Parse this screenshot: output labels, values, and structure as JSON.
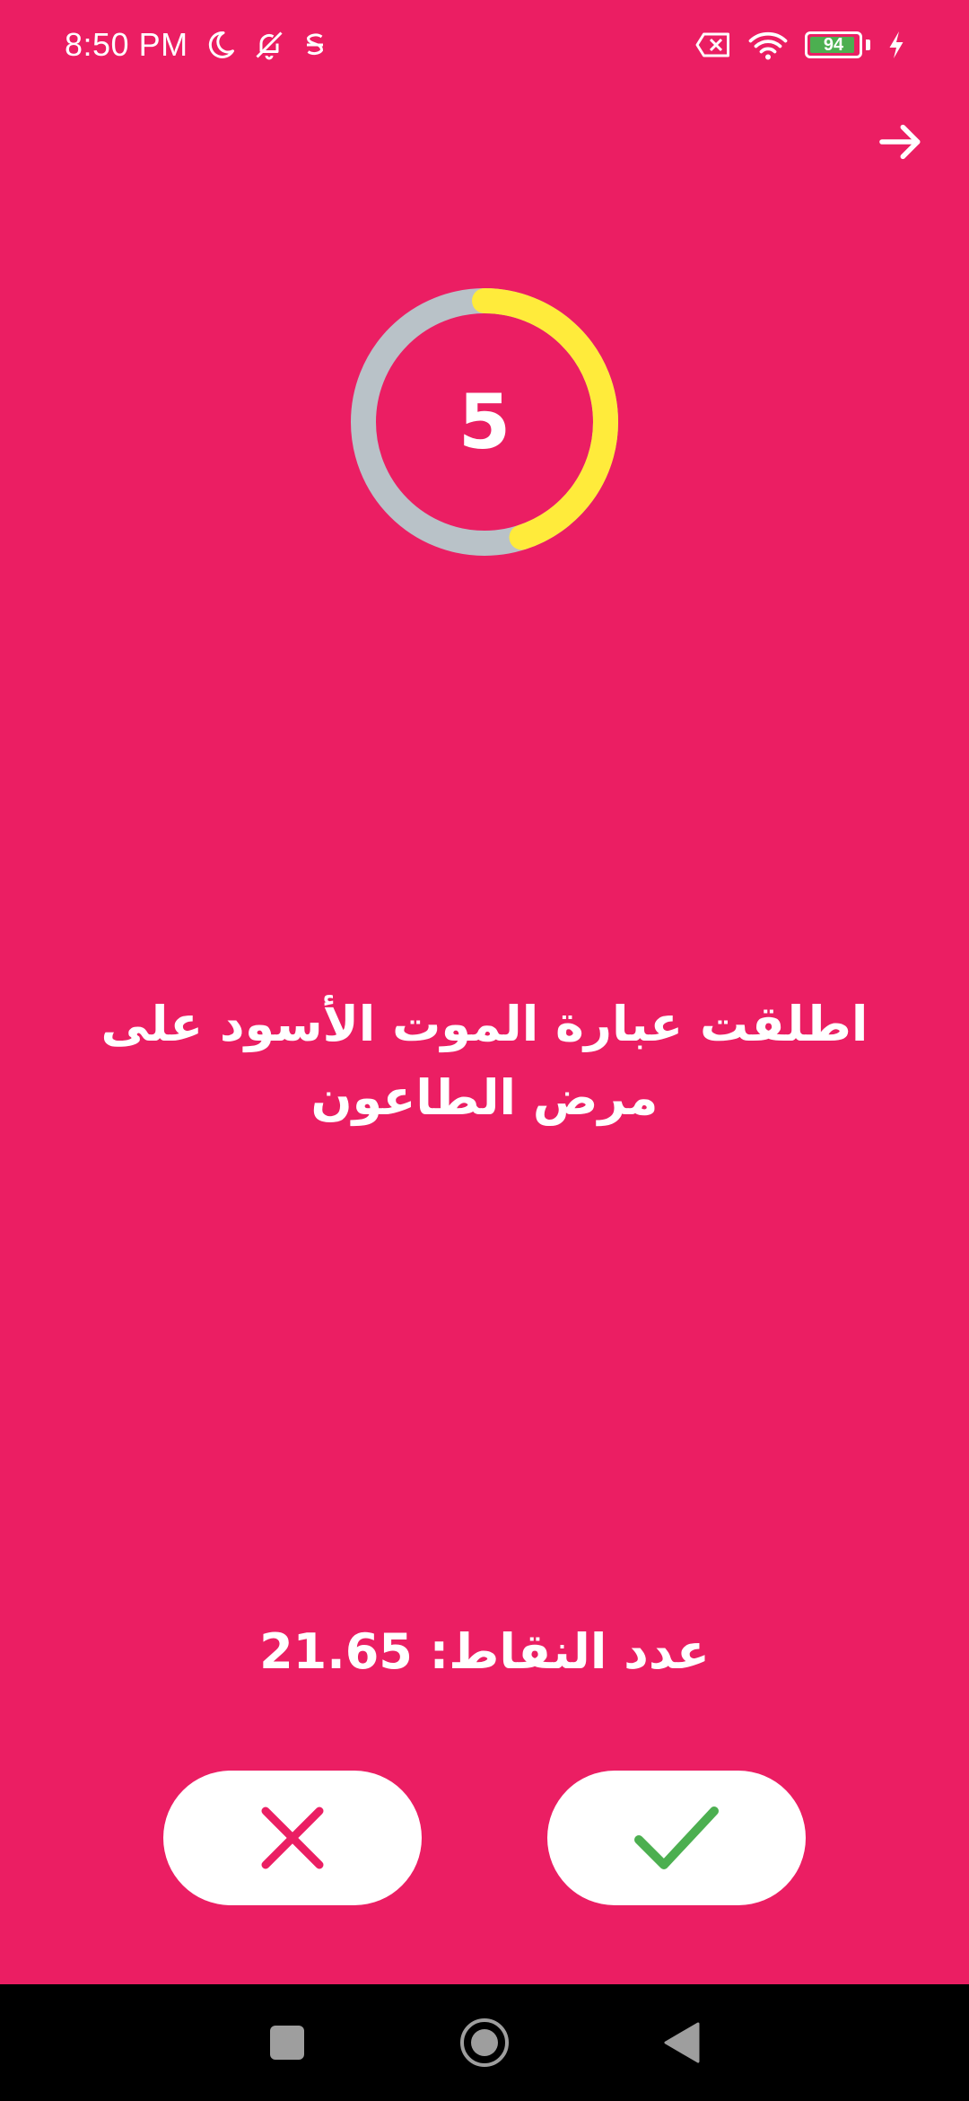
{
  "status_bar": {
    "time": "8:50 PM",
    "battery_level": "94",
    "left_icons": [
      "moon-icon",
      "bell-off-icon",
      "sync-icon"
    ],
    "right_icons": [
      "sim-off-icon",
      "wifi-icon",
      "battery-icon",
      "charging-icon"
    ]
  },
  "header": {
    "forward_icon": "arrow-right-icon"
  },
  "timer": {
    "value": "5",
    "remaining_fraction": 0.45,
    "progress_color": "#FFEB3B",
    "track_color": "#B9C2C8"
  },
  "question": {
    "text": "اطلقت عبارة الموت الأسود على مرض الطاعون"
  },
  "score": {
    "text": "عدد النقاط: 21.65"
  },
  "answers": {
    "wrong_icon": "x-icon",
    "wrong_color": "#EB1E63",
    "correct_icon": "check-icon",
    "correct_color": "#4CAF50"
  },
  "colors": {
    "background": "#EB1E63",
    "accent_white": "#FFFFFF"
  },
  "nav_bar": {
    "icons": [
      "square-recents-icon",
      "circle-home-icon",
      "triangle-back-icon"
    ]
  }
}
